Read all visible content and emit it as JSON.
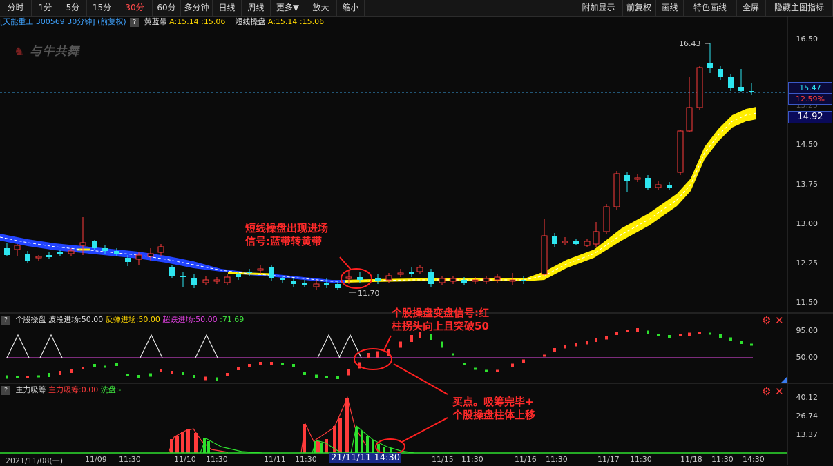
{
  "toolbar": {
    "left": [
      "分时",
      "1分",
      "5分",
      "15分",
      "30分",
      "60分",
      "多分钟",
      "日线",
      "周线",
      "更多▼",
      "放大",
      "缩小"
    ],
    "active": "30分",
    "right": [
      "附加显示",
      "前复权",
      "画线",
      "特色画线",
      "全屏",
      "隐藏主图指标"
    ]
  },
  "main_title": {
    "stock": "[天能重工 300569 30分钟] (前复权)",
    "ind1_name": "黄蓝带",
    "ind1_value": "A:15.14 :15.06",
    "ind2_name": "短线操盘",
    "ind2_value": "A:15.14 :15.06"
  },
  "watermark": "与牛共舞",
  "price_axis": [
    "16.50",
    "15.25",
    "14.50",
    "13.75",
    "13.00",
    "12.25",
    "11.50"
  ],
  "price_tags": {
    "last": "15.47",
    "pct": "12.59%",
    "ma": "14.92"
  },
  "high_label": "16.43",
  "low_label": "11.70",
  "pane2": {
    "name": "个股操盘",
    "v1": "波段进场:50.00",
    "v2": "反弹进场:50.00",
    "v3": "超跌进场:50.00",
    "v4": ":71.69",
    "axis": [
      "95.00",
      "50.00"
    ]
  },
  "pane3": {
    "name": "主力吸筹",
    "v1": "主力吸筹:0.00",
    "v2": "洗盘:-",
    "axis": [
      "40.12",
      "26.74",
      "13.37"
    ]
  },
  "dates": [
    "2021/11/08(一)",
    "11/09",
    "11:30",
    "11/10",
    "11:30",
    "11/11",
    "11:30",
    "21/11/11 14:30",
    "11/15",
    "11:30",
    "11/16",
    "11:30",
    "11/17",
    "11:30",
    "11/18",
    "11:30",
    "14:30"
  ],
  "annotations": {
    "a1_l1": "短线操盘出现进场",
    "a1_l2": "信号:蓝带转黄带",
    "a2_l1": "个股操盘变盘信号:红",
    "a2_l2": "柱拐头向上且突破50",
    "a3_l1": "买点。吸筹完毕+",
    "a3_l2": "个股操盘柱体上移"
  },
  "colors": {
    "up": "#ff3b3b",
    "down": "#2ee6f0",
    "yellow": "#ffee00",
    "blue": "#2244ff",
    "green": "#2ee02e",
    "magenta": "#d040d0"
  }
}
